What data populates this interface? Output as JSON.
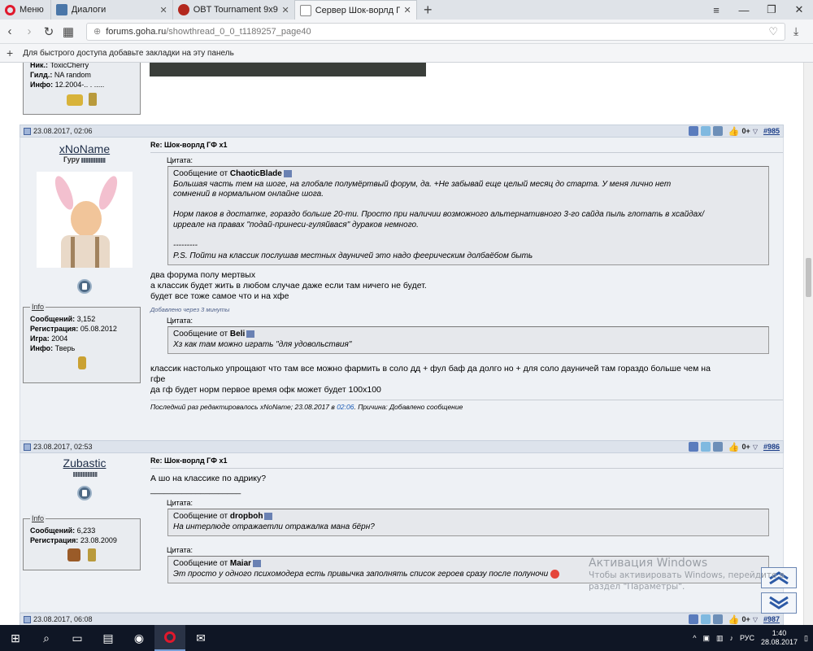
{
  "browser": {
    "menu_label": "Меню",
    "tabs": [
      {
        "title": "Диалоги",
        "icon": "vk-icon"
      },
      {
        "title": "OBT Tournament 9x9 - ан",
        "icon": "obt-icon"
      },
      {
        "title": "Сервер Шок-ворлд ГФ x1",
        "icon": "goha-icon",
        "active": true
      }
    ],
    "new_tab": "+",
    "url_domain": "forums.goha.ru",
    "url_path": "/showthread_0_0_t1189257_page40",
    "bookmark_hint": "Для быстрого доступа добавьте закладки на эту панель"
  },
  "prev_post": {
    "nick_label": "Ник.:",
    "nick_value": "ToxicCherry",
    "guild_label": "Гилд.:",
    "guild_value": "NA random",
    "info_label": "Инфо:",
    "info_value": "12.2004-.. . ....."
  },
  "posts": [
    {
      "date": "23.08.2017, 02:06",
      "rating": "0+",
      "number": "#985",
      "user": "xNoName",
      "user_title": "Гуру",
      "info_legend": "Info",
      "stats": [
        [
          "Сообщений:",
          "3,152"
        ],
        [
          "Регистрация:",
          "05.08.2012"
        ],
        [
          "Игра:",
          "2004"
        ],
        [
          "Инфо:",
          "Тверь"
        ]
      ],
      "title": "Re: Шок-ворлд ГФ x1",
      "quote1_label": "Цитата:",
      "quote1_from_prefix": "Сообщение от",
      "quote1_author": "ChaoticBlade",
      "quote1_lines": [
        "Большая часть тем на шоге, на глобале полумёртвый форум, да. +Не забывай еще целый месяц до старта. У меня лично нет",
        "сомнений в нормальном онлайне шога.",
        "",
        "Норм паков в достатке, гораздо больше 20-ти. Просто при наличии возможного альтернативного 3-го сайда пыль глотать в хсайдах/",
        "ирреале на правах \"подай-принеси-гуляйвася\" дураков немного.",
        "",
        "---------",
        "P.S. Пойти на классик послушав местных дауничей это надо феерическим долбаёбом быть"
      ],
      "text1": [
        "два форума полу мертвых",
        "а классик будет жить в любом случае даже если там ничего не будет.",
        "будет все тоже самое что и на хфе"
      ],
      "added_note": "Добавлено через 3 минуты",
      "quote2_label": "Цитата:",
      "quote2_from_prefix": "Сообщение от",
      "quote2_author": "Beli",
      "quote2_text": "Хз как там можно играть \"для удовольствия\"",
      "text2": [
        "классик настолько упрощают что там все можно фармить в соло дд + фул баф да долго но + для соло дауничей там гораздо больше чем на",
        "гфе",
        "да гф будет норм первое время офк может будет 100x100"
      ],
      "edit_prefix": "Последний раз редактировалось xNoName; 23.08.2017 в",
      "edit_time": "02:06",
      "edit_suffix": ". Причина: Добавлено сообщение"
    },
    {
      "date": "23.08.2017, 02:53",
      "rating": "0+",
      "number": "#986",
      "user": "Zubastic",
      "info_legend": "Info",
      "stats": [
        [
          "Сообщений:",
          "6,233"
        ],
        [
          "Регистрация:",
          "23.08.2009"
        ]
      ],
      "title": "Re: Шок-ворлд ГФ x1",
      "text": "А шо на классике по адрику?",
      "signature": "____________________",
      "quote1_label": "Цитата:",
      "quote1_from_prefix": "Сообщение от",
      "quote1_author": "dropboh",
      "quote1_text": "На интерлюде отражаетли отражалка мана бёрн?",
      "quote2_label": "Цитата:",
      "quote2_from_prefix": "Сообщение от",
      "quote2_author": "Maiar",
      "quote2_text": "Эт просто у одного психомодера есть привычка заполнять список героев сразу после полуночи"
    },
    {
      "date": "23.08.2017, 06:08",
      "rating": "0+",
      "number": "#987"
    }
  ],
  "watermark": {
    "title": "Активация Windows",
    "line1": "Чтобы активировать Windows, перейдите в",
    "line2": "раздел \"Параметры\"."
  },
  "taskbar": {
    "lang": "РУС",
    "time": "1:40",
    "date": "28.08.2017"
  }
}
